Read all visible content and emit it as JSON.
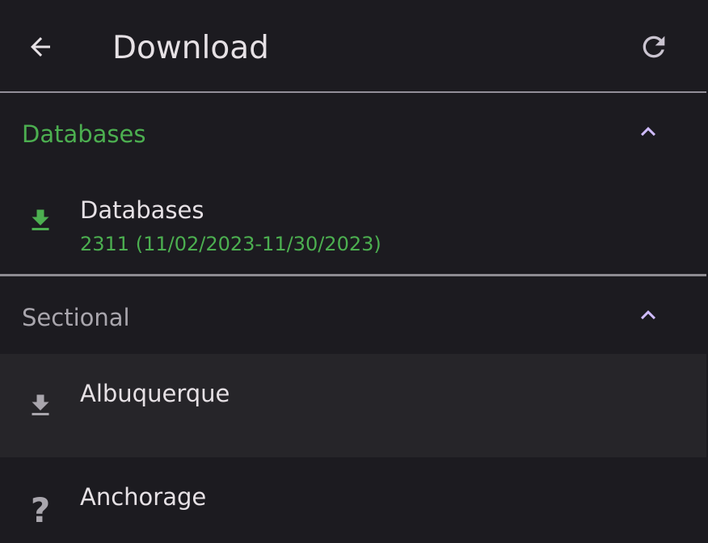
{
  "colors": {
    "background": "#1c1b20",
    "on_surface": "#e6e1e5",
    "accent_green": "#4caf50",
    "accent_purple": "#d0bcff",
    "muted": "#a9a6ad",
    "icon_muted": "#a9a6ad"
  },
  "header": {
    "title": "Download",
    "back_icon": "arrow-left-icon",
    "refresh_icon": "refresh-icon"
  },
  "sections": [
    {
      "title": "Databases",
      "state": "expanded",
      "chevron_icon": "chevron-up-icon",
      "items": [
        {
          "title": "Databases",
          "subtitle": "2311 (11/02/2023-11/30/2023)",
          "icon": "download-icon",
          "status": "current"
        }
      ]
    },
    {
      "title": "Sectional",
      "state": "expanded",
      "chevron_icon": "chevron-up-icon",
      "items": [
        {
          "title": "Albuquerque",
          "icon": "download-icon",
          "status": "not-downloaded"
        },
        {
          "title": "Anchorage",
          "icon": "question-icon",
          "glyph": "?",
          "status": "unknown"
        }
      ]
    }
  ]
}
